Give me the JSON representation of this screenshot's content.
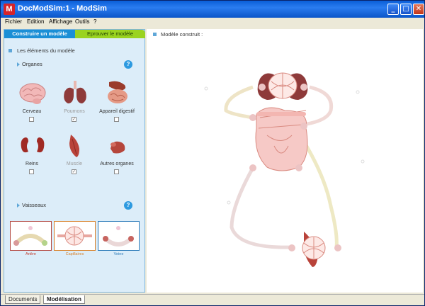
{
  "window": {
    "title": "DocModSim:1 - ModSim",
    "app_letter": "M"
  },
  "window_buttons": {
    "minimize": "_",
    "maximize": "□",
    "close": "✕"
  },
  "menu": [
    "Fichier",
    "Edition",
    "Affichage",
    "Outils",
    "?"
  ],
  "left_panel": {
    "tabs": [
      "Construire un modèle",
      "Eprouver le modèle"
    ],
    "section_title": "Les éléments du modèle",
    "organs_header": "Organes",
    "vessels_header": "Vaisseaux",
    "help_glyph": "?",
    "organs": [
      {
        "name": "Cerveau",
        "checked": false,
        "dimmed": false
      },
      {
        "name": "Poumons",
        "checked": true,
        "dimmed": true
      },
      {
        "name": "Appareil digestif",
        "checked": false,
        "dimmed": false
      },
      {
        "name": "Reins",
        "checked": false,
        "dimmed": false
      },
      {
        "name": "Muscle",
        "checked": true,
        "dimmed": true
      },
      {
        "name": "Autres organes",
        "checked": false,
        "dimmed": false
      }
    ],
    "vessels": [
      {
        "name": "Artère",
        "color": "#c0392b"
      },
      {
        "name": "Capillaires",
        "color": "#d9822b"
      },
      {
        "name": "Veine",
        "color": "#2a7ab8"
      }
    ]
  },
  "canvas": {
    "title": "Modèle construit :"
  },
  "bottom_tabs": [
    {
      "label": "Documents",
      "active": false
    },
    {
      "label": "Modélisation",
      "active": true
    }
  ],
  "colors": {
    "accent": "#1b8fd6",
    "secondary_tab": "#9ad320",
    "panel_bg": "#dcedf9"
  }
}
